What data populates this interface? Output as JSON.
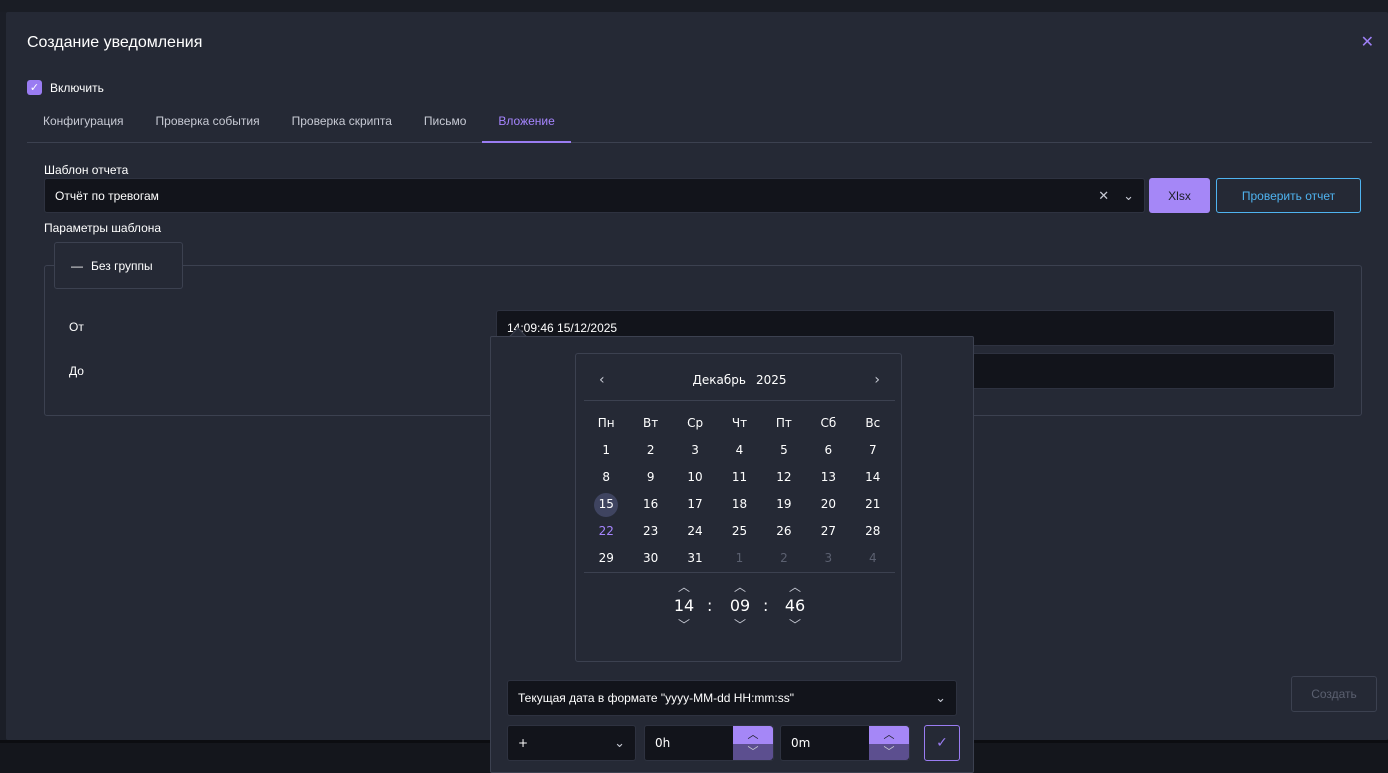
{
  "dialog": {
    "title": "Создание уведомления",
    "enable_label": "Включить",
    "enabled": true
  },
  "tabs": [
    {
      "label": "Конфигурация"
    },
    {
      "label": "Проверка события"
    },
    {
      "label": "Проверка скрипта"
    },
    {
      "label": "Письмо"
    },
    {
      "label": "Вложение"
    }
  ],
  "active_tab": "Вложение",
  "report": {
    "template_label": "Шаблон отчета",
    "template_value": "Отчёт по тревогам",
    "format_button": "Xlsx",
    "check_button": "Проверить отчет",
    "params_label": "Параметры шаблона",
    "group_label": "Без группы"
  },
  "fields": {
    "from_label": "От",
    "from_value": "14:09:46 15/12/2025",
    "to_label": "До",
    "to_value": ""
  },
  "create_button": "Создать",
  "picker": {
    "month": "Декабрь",
    "year": "2025",
    "weekdays": [
      "Пн",
      "Вт",
      "Ср",
      "Чт",
      "Пт",
      "Сб",
      "Вс"
    ],
    "days": [
      {
        "n": "1",
        "other": false
      },
      {
        "n": "2",
        "other": false
      },
      {
        "n": "3",
        "other": false
      },
      {
        "n": "4",
        "other": false
      },
      {
        "n": "5",
        "other": false
      },
      {
        "n": "6",
        "other": false
      },
      {
        "n": "7",
        "other": false
      },
      {
        "n": "8",
        "other": false
      },
      {
        "n": "9",
        "other": false
      },
      {
        "n": "10",
        "other": false
      },
      {
        "n": "11",
        "other": false
      },
      {
        "n": "12",
        "other": false
      },
      {
        "n": "13",
        "other": false
      },
      {
        "n": "14",
        "other": false
      },
      {
        "n": "15",
        "other": false,
        "selected": true
      },
      {
        "n": "16",
        "other": false
      },
      {
        "n": "17",
        "other": false
      },
      {
        "n": "18",
        "other": false
      },
      {
        "n": "19",
        "other": false
      },
      {
        "n": "20",
        "other": false
      },
      {
        "n": "21",
        "other": false
      },
      {
        "n": "22",
        "other": false,
        "today": true
      },
      {
        "n": "23",
        "other": false
      },
      {
        "n": "24",
        "other": false
      },
      {
        "n": "25",
        "other": false
      },
      {
        "n": "26",
        "other": false
      },
      {
        "n": "27",
        "other": false
      },
      {
        "n": "28",
        "other": false
      },
      {
        "n": "29",
        "other": false
      },
      {
        "n": "30",
        "other": false
      },
      {
        "n": "31",
        "other": false
      },
      {
        "n": "1",
        "other": true
      },
      {
        "n": "2",
        "other": true
      },
      {
        "n": "3",
        "other": true
      },
      {
        "n": "4",
        "other": true
      }
    ],
    "hours": "14",
    "minutes": "09",
    "seconds": "46",
    "format_select": "Текущая дата в формате \"yyyy-MM-dd HH:mm:ss\"",
    "sign": "+",
    "offset_hours": "0h",
    "offset_minutes": "0m"
  },
  "colors": {
    "accent": "#9a7cf2",
    "accent_light": "#a587f7",
    "link_blue": "#4fb3f0",
    "background": "#252935",
    "input_bg": "#12141b"
  }
}
